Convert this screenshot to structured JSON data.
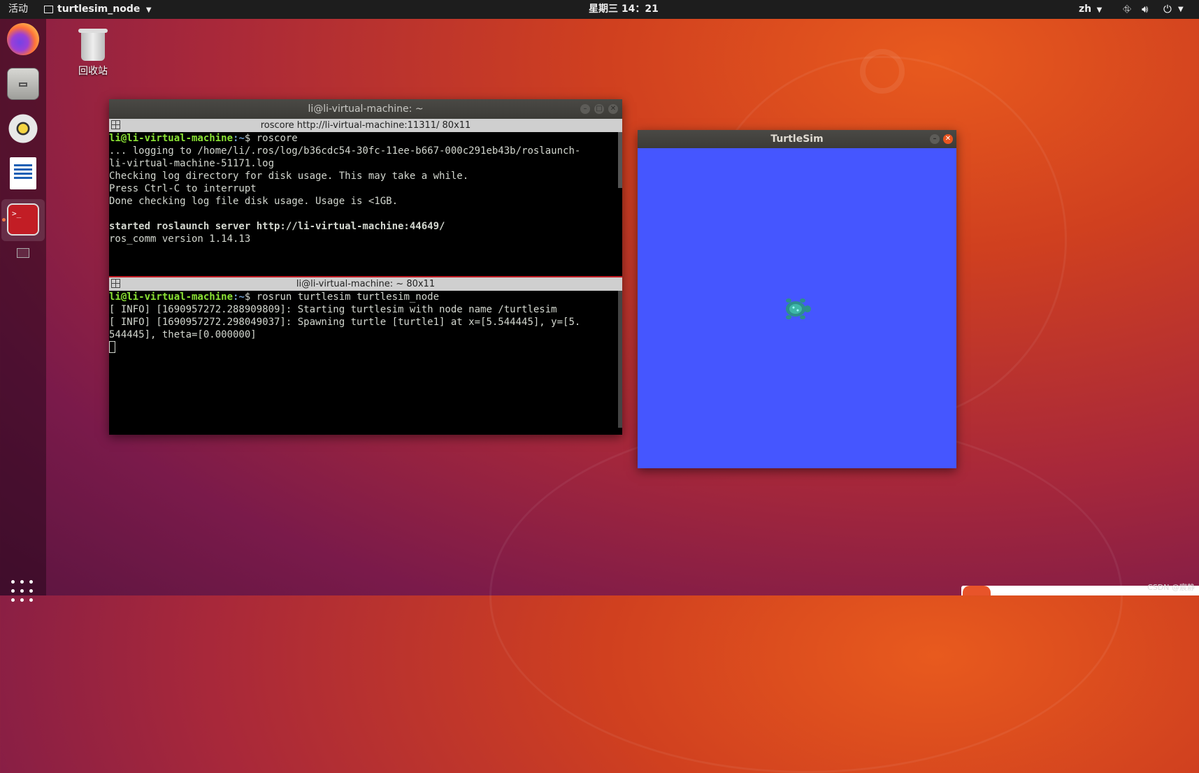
{
  "topbar": {
    "activities": "活动",
    "app_name": "turtlesim_node",
    "clock": "星期三 14：21",
    "input_method": "zh"
  },
  "desktop": {
    "trash_label": "回收站"
  },
  "terminal": {
    "window_title": "li@li-virtual-machine: ~",
    "pane1": {
      "title": "roscore http://li-virtual-machine:11311/ 80x11",
      "prompt_user": "li@li-virtual-machine",
      "prompt_path": ":~",
      "prompt_suffix": "$ roscore",
      "lines": [
        "... logging to /home/li/.ros/log/b36cdc54-30fc-11ee-b667-000c291eb43b/roslaunch-",
        "li-virtual-machine-51171.log",
        "Checking log directory for disk usage. This may take a while.",
        "Press Ctrl-C to interrupt",
        "Done checking log file disk usage. Usage is <1GB.",
        ""
      ],
      "bold_line": "started roslaunch server http://li-virtual-machine:44649/",
      "last_line": "ros_comm version 1.14.13"
    },
    "pane2": {
      "title": "li@li-virtual-machine: ~ 80x11",
      "prompt_user": "li@li-virtual-machine",
      "prompt_path": ":~",
      "prompt_suffix": "$ rosrun turtlesim turtlesim_node",
      "lines": [
        "[ INFO] [1690957272.288909809]: Starting turtlesim with node name /turtlesim",
        "[ INFO] [1690957272.298049037]: Spawning turtle [turtle1] at x=[5.544445], y=[5.",
        "544445], theta=[0.000000]"
      ]
    }
  },
  "turtlesim": {
    "window_title": "TurtleSim",
    "background_color": "#4556ff",
    "turtle_icon": "turtle-icon"
  },
  "watermark": "CSDN @宸静",
  "colors": {
    "prompt_user": "#8ae234",
    "prompt_path": "#729fcf",
    "terminal_text": "#d3d7cf"
  }
}
